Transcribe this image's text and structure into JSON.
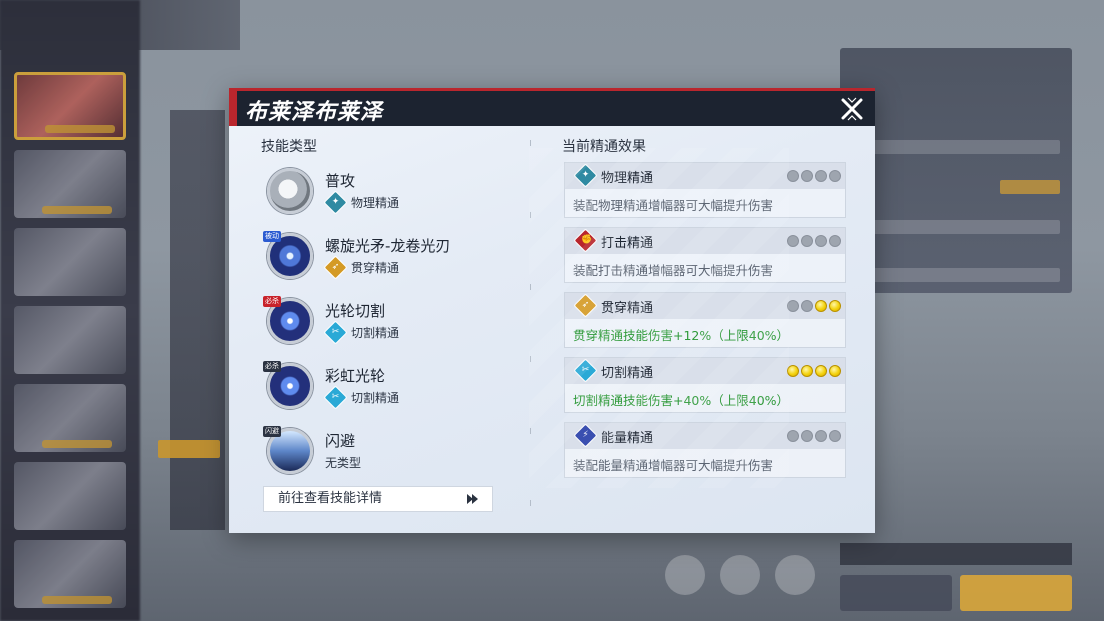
{
  "modal": {
    "title": "布莱泽布莱泽",
    "left_section_title": "技能类型",
    "right_section_title": "当前精通效果",
    "detail_button": "前往查看技能详情"
  },
  "skills": [
    {
      "name": "普攻",
      "type": "物理精通",
      "icon": "basic-attack-icon",
      "badge": ""
    },
    {
      "name": "螺旋光矛-龙卷光刃",
      "type": "贯穿精通",
      "icon": "spiral-lance-icon",
      "badge": "被动"
    },
    {
      "name": "光轮切割",
      "type": "切割精通",
      "icon": "light-wheel-icon",
      "badge": "必杀"
    },
    {
      "name": "彩虹光轮",
      "type": "切割精通",
      "icon": "rainbow-wheel-icon",
      "badge": "必杀"
    },
    {
      "name": "闪避",
      "type": "无类型",
      "icon": "dodge-icon",
      "badge": "闪避"
    }
  ],
  "masteries": [
    {
      "name": "物理精通",
      "desc": "装配物理精通增幅器可大幅提升伤害",
      "level": 0,
      "max": 4,
      "color": "#2f8aa2"
    },
    {
      "name": "打击精通",
      "desc": "装配打击精通增幅器可大幅提升伤害",
      "level": 0,
      "max": 4,
      "color": "#b8262d"
    },
    {
      "name": "贯穿精通",
      "desc": "贯穿精通技能伤害+12%（上限40%）",
      "level": 2,
      "max": 4,
      "color": "#d49a25"
    },
    {
      "name": "切割精通",
      "desc": "切割精通技能伤害+40%（上限40%）",
      "level": 4,
      "max": 4,
      "color": "#2aa9d6"
    },
    {
      "name": "能量精通",
      "desc": "装配能量精通增幅器可大幅提升伤害",
      "level": 0,
      "max": 4,
      "color": "#3a4fb0"
    }
  ],
  "colors": {
    "header_bg": "#1c2330",
    "accent_red": "#b9262d",
    "active_text": "#2f9a3a",
    "dot_on": "#f3d20c"
  }
}
